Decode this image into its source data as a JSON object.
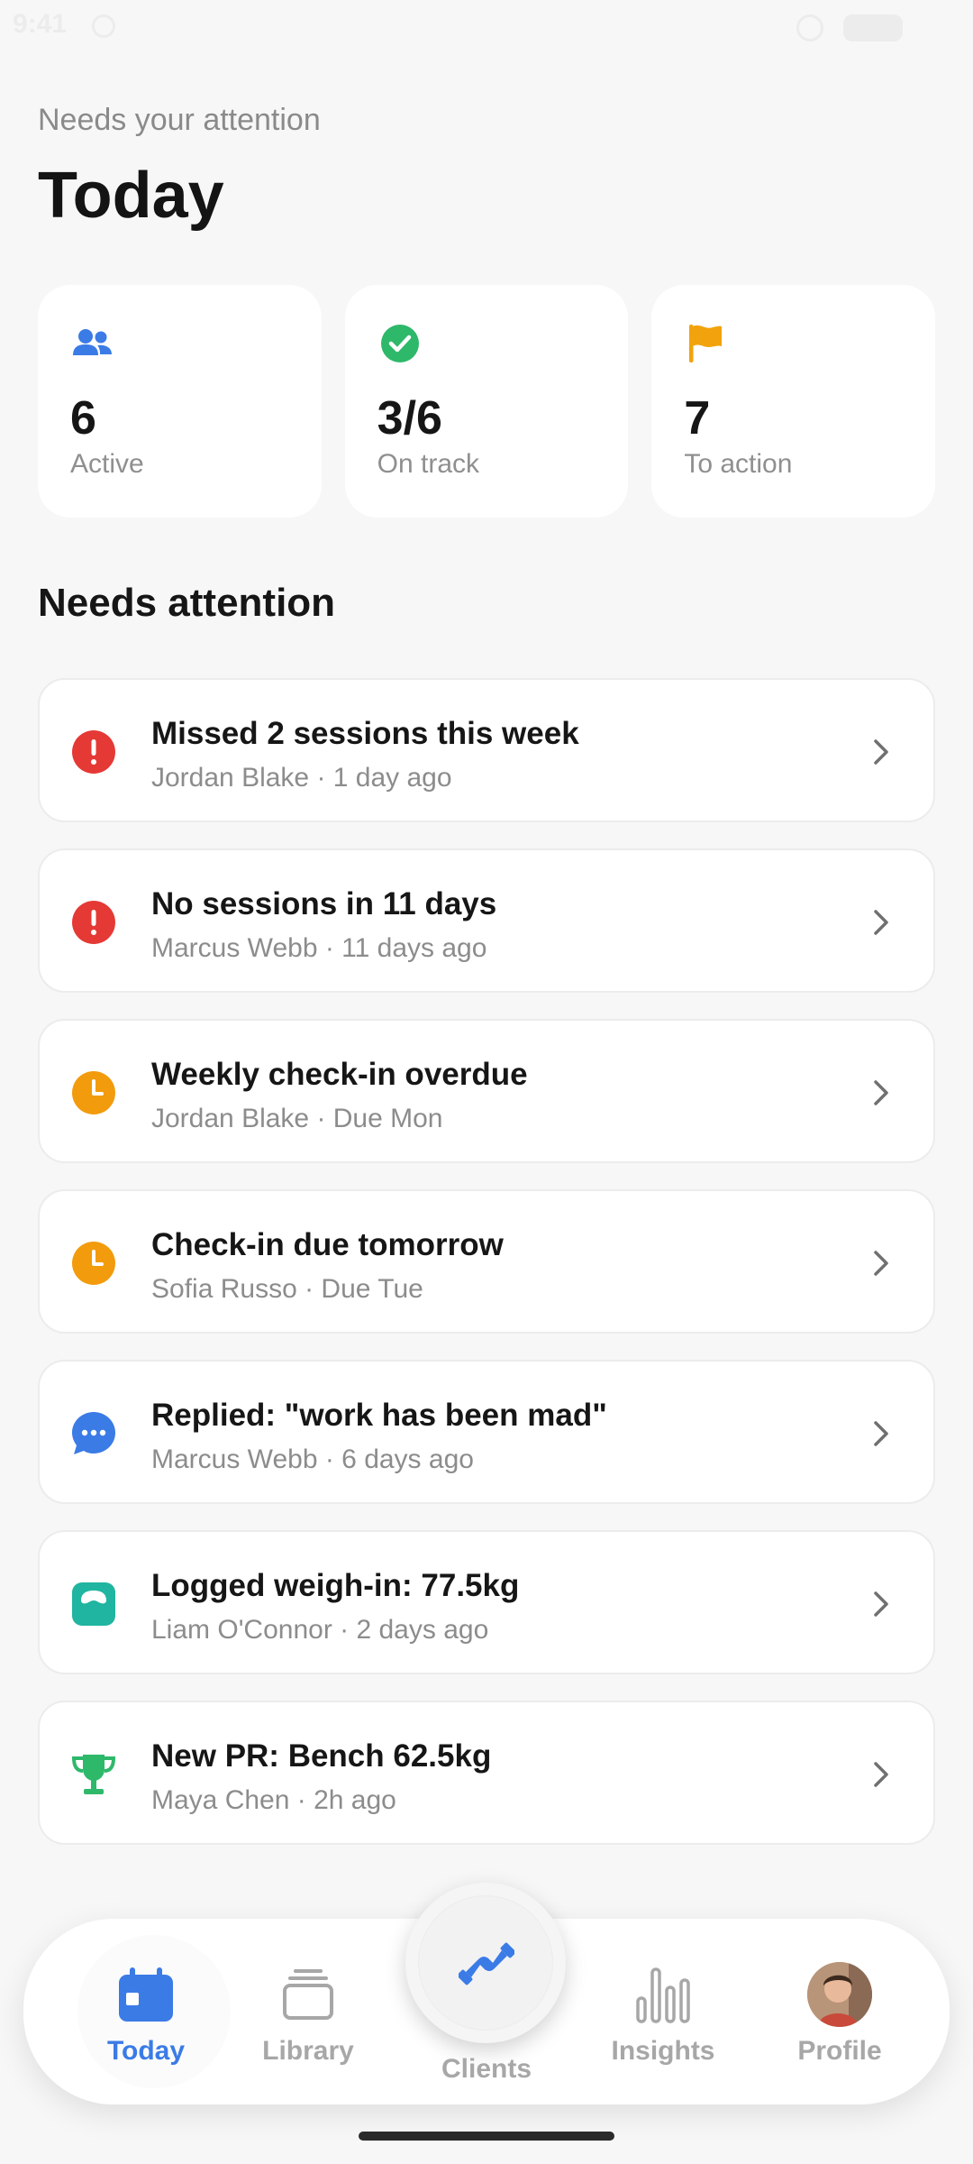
{
  "status_bar": {
    "time": "9:41"
  },
  "header": {
    "subtitle": "Needs your attention",
    "title": "Today"
  },
  "stats": [
    {
      "icon": "users-icon",
      "value": "6",
      "label": "Active",
      "color": "#3b7be6"
    },
    {
      "icon": "check-circle-icon",
      "value": "3/6",
      "label": "On track",
      "color": "#2eb86a"
    },
    {
      "icon": "flag-icon",
      "value": "7",
      "label": "To action",
      "color": "#f2a20c"
    }
  ],
  "section": {
    "title": "Needs attention"
  },
  "alerts": [
    {
      "icon": "alert-icon",
      "color": "#e53935",
      "title": "Missed 2 sessions this week",
      "meta": "Jordan Blake · 1 day ago"
    },
    {
      "icon": "alert-icon",
      "color": "#e53935",
      "title": "No sessions in 11 days",
      "meta": "Marcus Webb · 11 days ago"
    },
    {
      "icon": "clock-icon",
      "color": "#f29b0c",
      "title": "Weekly check-in overdue",
      "meta": "Jordan Blake · Due Mon"
    },
    {
      "icon": "clock-icon",
      "color": "#f29b0c",
      "title": "Check-in due tomorrow",
      "meta": "Sofia Russo · Due Tue"
    },
    {
      "icon": "chat-bubble-icon",
      "color": "#3b7be6",
      "title": "Replied: \"work has been mad\"",
      "meta": "Marcus Webb · 6 days ago"
    },
    {
      "icon": "scale-icon",
      "color": "#1fb5a0",
      "title": "Logged weigh-in: 77.5kg",
      "meta": "Liam O'Connor · 2 days ago"
    },
    {
      "icon": "trophy-icon",
      "color": "#2eb86a",
      "title": "New PR: Bench 62.5kg",
      "meta": "Maya Chen · 2h ago"
    }
  ],
  "nav": {
    "today": "Today",
    "library": "Library",
    "clients": "Clients",
    "insights": "Insights",
    "profile": "Profile",
    "active_color": "#3b7be6",
    "inactive_color": "#a7a7a7"
  }
}
